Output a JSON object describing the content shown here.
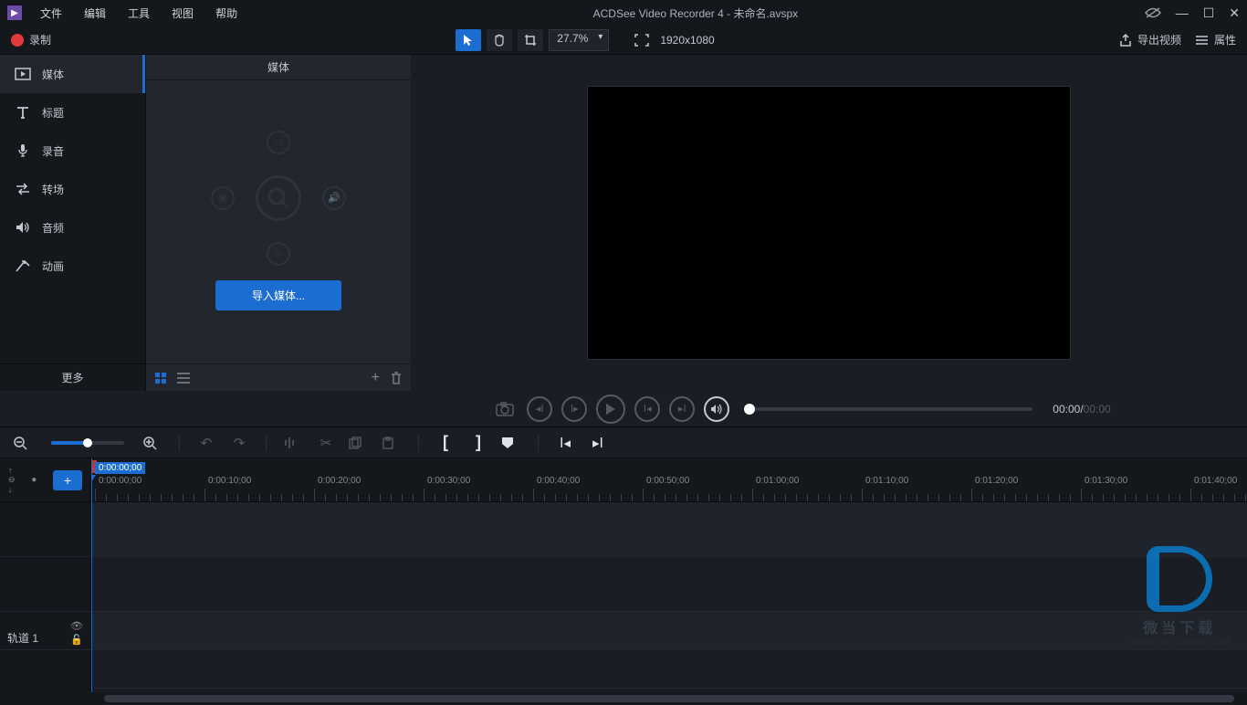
{
  "titlebar": {
    "app_title": "ACDSee Video Recorder 4 - 未命名.avspx",
    "menu": [
      "文件",
      "编辑",
      "工具",
      "视图",
      "帮助"
    ]
  },
  "toolbar": {
    "record_label": "录制",
    "zoom_value": "27.7%",
    "resolution": "1920x1080",
    "export_label": "导出视频",
    "properties_label": "属性"
  },
  "sidebar": {
    "items": [
      {
        "label": "媒体"
      },
      {
        "label": "标题"
      },
      {
        "label": "录音"
      },
      {
        "label": "转场"
      },
      {
        "label": "音频"
      },
      {
        "label": "动画"
      }
    ],
    "more_label": "更多"
  },
  "media_panel": {
    "header": "媒体",
    "import_label": "导入媒体..."
  },
  "playback": {
    "current": "00:00",
    "duration": "00:00"
  },
  "timeline": {
    "playhead_label": "0:00:00;00",
    "ticks": [
      "0:00:00;00",
      "0:00:10;00",
      "0:00:20;00",
      "0:00:30;00",
      "0:00:40;00",
      "0:00:50;00",
      "0:01:00;00",
      "0:01:10;00",
      "0:01:20;00",
      "0:01:30;00",
      "0:01:40;00"
    ],
    "track1_label": "轨道 1"
  },
  "watermark": {
    "text1": "微当下载",
    "text2": "WWW.WEIDOWN.COM"
  }
}
